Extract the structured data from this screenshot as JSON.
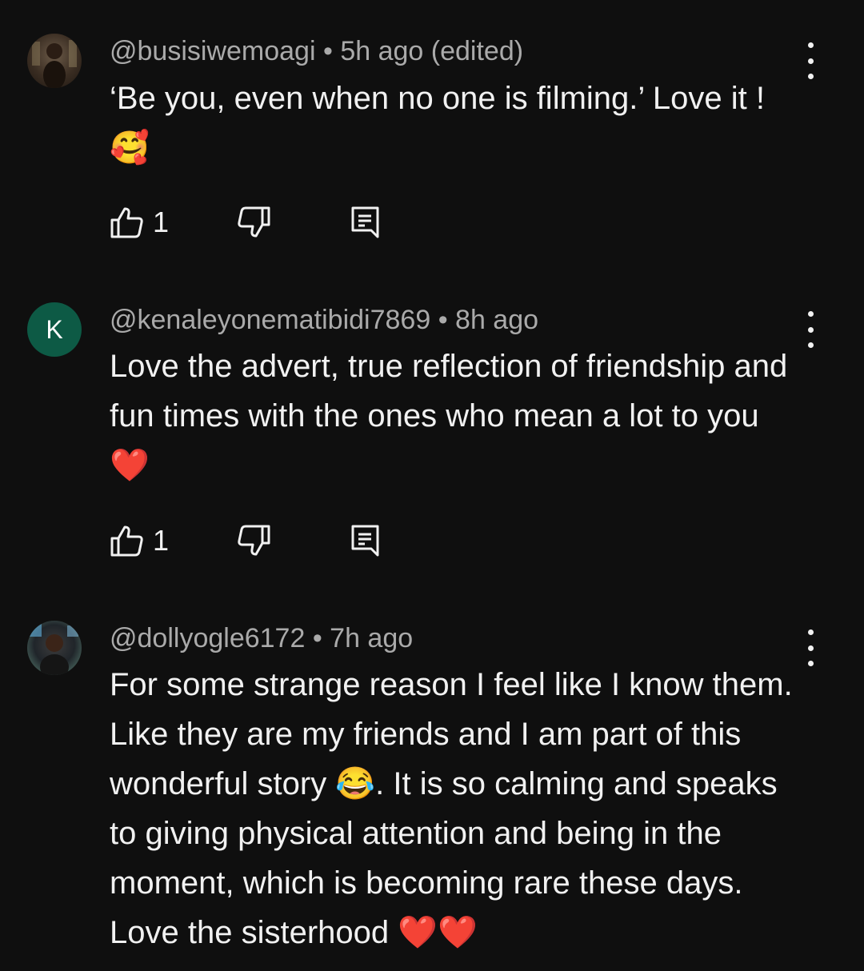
{
  "comments": [
    {
      "handle": "@busisiwemoagi",
      "separator": "•",
      "time": "5h ago (edited)",
      "avatar_letter": "",
      "text": "‘Be you, even when no one is filming.’ Love it !",
      "emoji": "🥰",
      "likes": "1"
    },
    {
      "handle": "@kenaleyonematibidi7869",
      "separator": "•",
      "time": "8h ago",
      "avatar_letter": "K",
      "text": "Love the advert, true reflection of friendship and fun times with the ones who mean a lot to you",
      "emoji": "❤️",
      "likes": "1"
    },
    {
      "handle": "@dollyogle6172",
      "separator": "•",
      "time": "7h ago",
      "avatar_letter": "",
      "text_part1": "For some strange reason I feel like I know them. Like they are my friends and I am part of this wonderful story",
      "emoji": "😂",
      "text_part2": ". It is so calming and speaks to giving physical attention and being in the moment, which is becoming rare these days. Love the sisterhood",
      "emoji_end": "❤️❤️"
    }
  ],
  "colors": {
    "background": "#0f0f0f",
    "text": "#f1f1f1",
    "meta": "#aaaaaa",
    "avatar_k": "#0d5a45"
  }
}
